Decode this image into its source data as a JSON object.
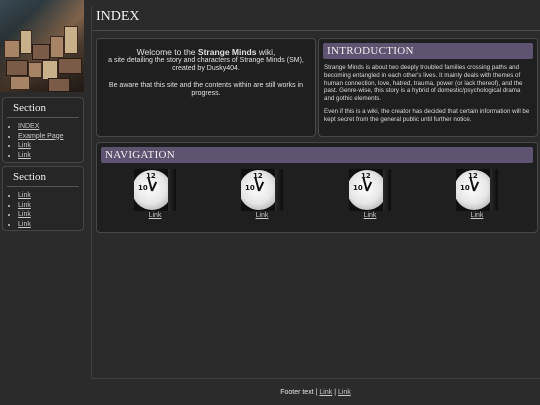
{
  "sidebar": {
    "sections": [
      {
        "title": "Section",
        "links": [
          "INDEX",
          "Example Page",
          "Link",
          "Link"
        ]
      },
      {
        "title": "Section",
        "links": [
          "Link",
          "Link",
          "Link",
          "Link"
        ]
      }
    ]
  },
  "main": {
    "title": "INDEX",
    "welcome": {
      "line1_prefix": "Welcome to the ",
      "line1_bold": "Strange Minds",
      "line1_suffix": " wiki,",
      "line2": "a site detailing the story and characters of Strange Minds (SM),",
      "line3": "created by Dusky404.",
      "line4": "Be aware that this site and the contents within are still works in",
      "line5": "progress."
    },
    "introduction": {
      "heading": "INTRODUCTION",
      "para1": "Strange Minds is about two deeply troubled families crossing paths and becoming entangled in each other's lives. It mainly deals with themes of human connection, love, hatred, trauma, power (or lack thereof), and the past. Genre-wise, this story is a hybrid of domestic/psychological drama and gothic elements.",
      "para2": "Even if this is a wiki, the creator has decided that certain information will be kept secret from the general public until further notice."
    },
    "navigation": {
      "heading": "NAVIGATION",
      "items": [
        {
          "label": "Link",
          "icon": "clock-icon"
        },
        {
          "label": "Link",
          "icon": "clock-icon"
        },
        {
          "label": "Link",
          "icon": "clock-icon"
        },
        {
          "label": "Link",
          "icon": "clock-icon"
        }
      ]
    }
  },
  "footer": {
    "text": "Footer text",
    "sep": "|",
    "links": [
      "Link",
      "Link"
    ]
  },
  "colors": {
    "background": "#2b2b2b",
    "panel": "#1f1f1f",
    "heading_bar": "#5e5370"
  }
}
